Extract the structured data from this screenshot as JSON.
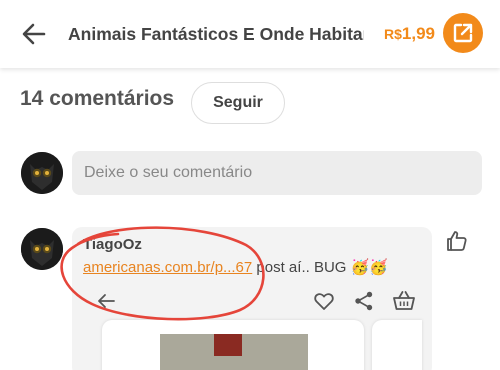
{
  "header": {
    "title": "Animais Fantásticos E Onde Habitam",
    "price_currency": "R$",
    "price_value": "1,99"
  },
  "comments_section": {
    "count_label": "14 comentários",
    "follow_label": "Seguir",
    "input_placeholder": "Deixe o seu comentário"
  },
  "comments": [
    {
      "author": "TiagoOz",
      "link_text": "americanas.com.br/p...67",
      "text_after": " post aí.. BUG ",
      "emojis": "🥳🥳"
    }
  ],
  "colors": {
    "accent": "#f28a1a",
    "link": "#e88420",
    "annotation": "#e5453a"
  },
  "icons": [
    "arrow-left-icon",
    "external-link-icon",
    "thumbs-up-icon",
    "heart-icon",
    "share-icon",
    "cart-icon"
  ]
}
